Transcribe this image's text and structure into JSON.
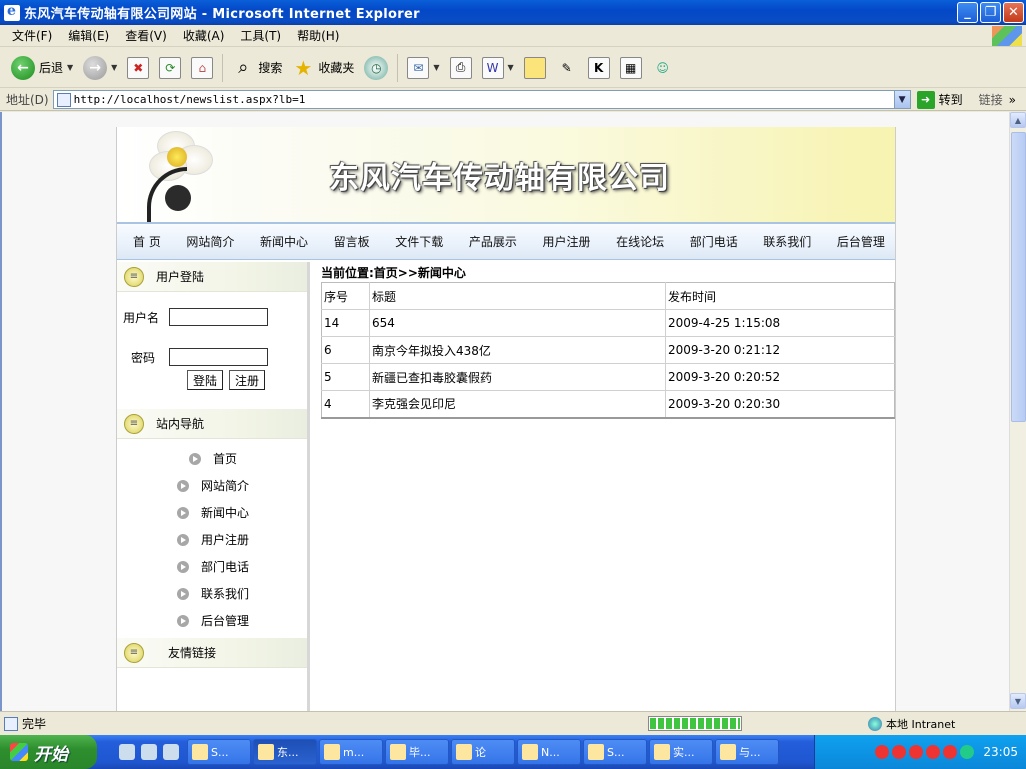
{
  "window": {
    "title": "东风汽车传动轴有限公司网站 - Microsoft Internet Explorer"
  },
  "menu": [
    "文件(F)",
    "编辑(E)",
    "查看(V)",
    "收藏(A)",
    "工具(T)",
    "帮助(H)"
  ],
  "toolbar": {
    "back_label": "后退",
    "search_label": "搜索",
    "favorites_label": "收藏夹"
  },
  "address": {
    "label": "地址(D)",
    "url": "http://localhost/newslist.aspx?lb=1",
    "go_label": "转到",
    "links_label": "链接"
  },
  "site": {
    "title": "东风汽车传动轴有限公司",
    "nav": [
      "首 页",
      "网站简介",
      "新闻中心",
      "留言板",
      "文件下载",
      "产品展示",
      "用户注册",
      "在线论坛",
      "部门电话",
      "联系我们",
      "后台管理"
    ]
  },
  "login": {
    "title": "用户登陆",
    "username_label": "用户名",
    "password_label": "密码",
    "login_button": "登陆",
    "register_button": "注册"
  },
  "sitenav": {
    "title": "站内导航",
    "items": [
      "首页",
      "网站简介",
      "新闻中心",
      "用户注册",
      "部门电话",
      "联系我们",
      "后台管理"
    ]
  },
  "friend_links": {
    "title": "友情链接"
  },
  "breadcrumb": "当前位置:首页>>新闻中心",
  "news": {
    "headers": [
      "序号",
      "标题",
      "发布时间"
    ],
    "rows": [
      {
        "id": "14",
        "title": "654",
        "time": "2009-4-25 1:15:08"
      },
      {
        "id": "6",
        "title": "南京今年拟投入438亿",
        "time": "2009-3-20 0:21:12"
      },
      {
        "id": "5",
        "title": "新疆已查扣毒胶囊假药",
        "time": "2009-3-20 0:20:52"
      },
      {
        "id": "4",
        "title": "李克强会见印尼",
        "time": "2009-3-20 0:20:30"
      }
    ]
  },
  "status": {
    "text": "完毕",
    "zone": "本地 Intranet"
  },
  "taskbar": {
    "start_label": "开始",
    "tasks": [
      "S...",
      "东...",
      "m...",
      "毕...",
      "论",
      "N...",
      "S...",
      "实...",
      "与..."
    ],
    "clock": "23:05"
  }
}
